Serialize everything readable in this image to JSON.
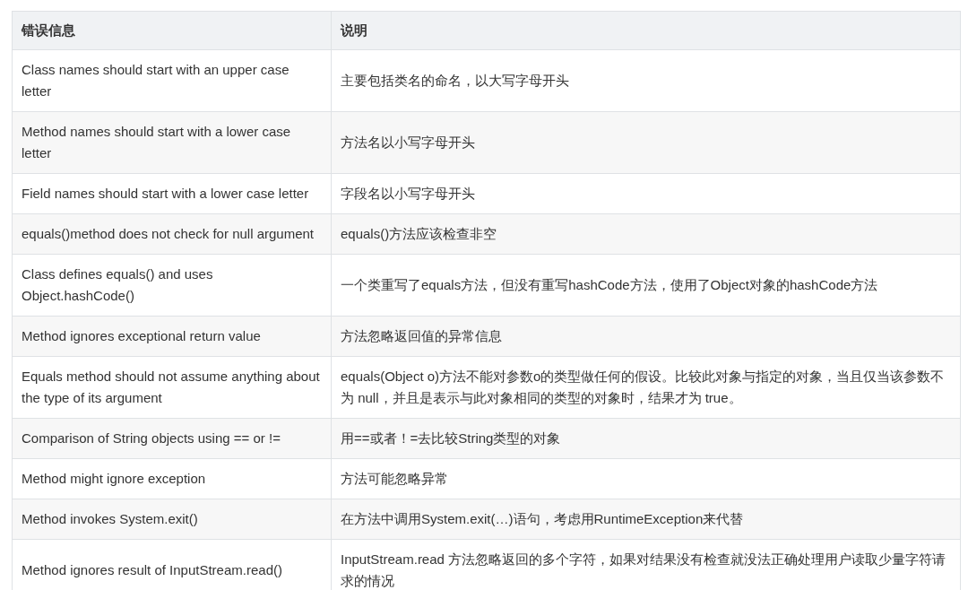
{
  "table": {
    "columns": [
      "错误信息",
      "说明"
    ],
    "rows": [
      [
        "Class names should start with an upper case letter",
        "主要包括类名的命名，以大写字母开头"
      ],
      [
        "Method names should start with a lower case letter",
        "方法名以小写字母开头"
      ],
      [
        "Field names should start with a lower case letter",
        "字段名以小写字母开头"
      ],
      [
        "equals()method does not check for null argument",
        "equals()方法应该检查非空"
      ],
      [
        "Class defines equals() and uses Object.hashCode()",
        "一个类重写了equals方法，但没有重写hashCode方法，使用了Object对象的hashCode方法"
      ],
      [
        "Method ignores exceptional return value",
        "方法忽略返回值的异常信息"
      ],
      [
        "Equals method should not assume anything about the type of its argument",
        "equals(Object o)方法不能对参数o的类型做任何的假设。比较此对象与指定的对象，当且仅当该参数不为 null，并且是表示与此对象相同的类型的对象时，结果才为 true。"
      ],
      [
        "Comparison of String objects using == or !=",
        "用==或者！=去比较String类型的对象"
      ],
      [
        "Method might ignore exception",
        "方法可能忽略异常"
      ],
      [
        "Method invokes System.exit()",
        "在方法中调用System.exit(…)语句，考虑用RuntimeException来代替"
      ],
      [
        "Method ignores result of InputStream.read()",
        "InputStream.read 方法忽略返回的多个字符，如果对结果没有检查就没法正确处理用户读取少量字符请求的情况"
      ]
    ]
  }
}
